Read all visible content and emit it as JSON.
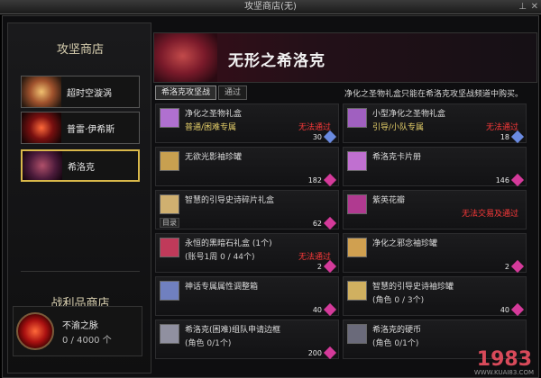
{
  "window": {
    "title": "攻坚商店(无)",
    "pin_icon": "pin-icon",
    "close_icon": "close-icon"
  },
  "left": {
    "title": "攻坚商店",
    "shops": [
      {
        "label": "超时空漩涡",
        "active": false
      },
      {
        "label": "普雷·伊希斯",
        "active": false
      },
      {
        "label": "希洛克",
        "active": true
      }
    ],
    "spoils_title": "战利品商店",
    "spoils": {
      "name": "不渝之脉",
      "count": "0 / 4000 个"
    }
  },
  "banner": {
    "title": "无形之希洛克"
  },
  "tabs": [
    {
      "label": "希洛克攻坚战",
      "active": true
    },
    {
      "label": "通过",
      "active": false
    }
  ],
  "notice": "净化之圣物礼盒只能在希洛克攻坚战频道中购买。",
  "items": [
    {
      "name": "净化之圣物礼盒",
      "sub": "普通/困难专属",
      "warn": "无法通过",
      "price": "30",
      "btn": ""
    },
    {
      "name": "小型净化之圣物礼盒",
      "sub": "引导/小队专属",
      "warn": "无法通过",
      "price": "18",
      "btn": ""
    },
    {
      "name": "无欲光影袖珍罐",
      "sub": "",
      "warn": "",
      "price": "182",
      "btn": ""
    },
    {
      "name": "希洛克卡片册",
      "sub": "",
      "warn": "",
      "price": "146",
      "btn": ""
    },
    {
      "name": "智慧的引导史诗碎片礼盒",
      "sub": "",
      "warn": "",
      "price": "62",
      "btn": "目录"
    },
    {
      "name": "紫英花瓣",
      "sub": "",
      "warn": "无法交易及通过",
      "price": "",
      "btn": ""
    },
    {
      "name": "永恒的黑暗石礼盒 (1个)",
      "sub": "(账号1周 0 / 44个)",
      "warn": "无法通过",
      "price": "2",
      "btn": ""
    },
    {
      "name": "净化之邪念袖珍罐",
      "sub": "",
      "warn": "",
      "price": "2",
      "btn": ""
    },
    {
      "name": "神话专属属性调整箱",
      "sub": "",
      "warn": "",
      "price": "40",
      "btn": ""
    },
    {
      "name": "智慧的引导史诗袖珍罐",
      "sub": "(角色 0 / 3个)",
      "warn": "",
      "price": "40",
      "btn": ""
    },
    {
      "name": "希洛克(困难)组队申请边框",
      "sub": "(角色 0/1个)",
      "warn": "",
      "price": "200",
      "btn": ""
    },
    {
      "name": "希洛克的硬币",
      "sub": "(角色 0/1个)",
      "warn": "",
      "price": "",
      "btn": ""
    }
  ],
  "colors": {
    "gold_border": "#d9b84a",
    "warn_red": "#ff3a3a",
    "sub_yellow": "#e6d06a",
    "gem_pink": "#d43a9a",
    "icon_purple": "#8a3aa0"
  },
  "watermark": {
    "logo": "1983",
    "url": "WWW.KUAI83.COM"
  }
}
